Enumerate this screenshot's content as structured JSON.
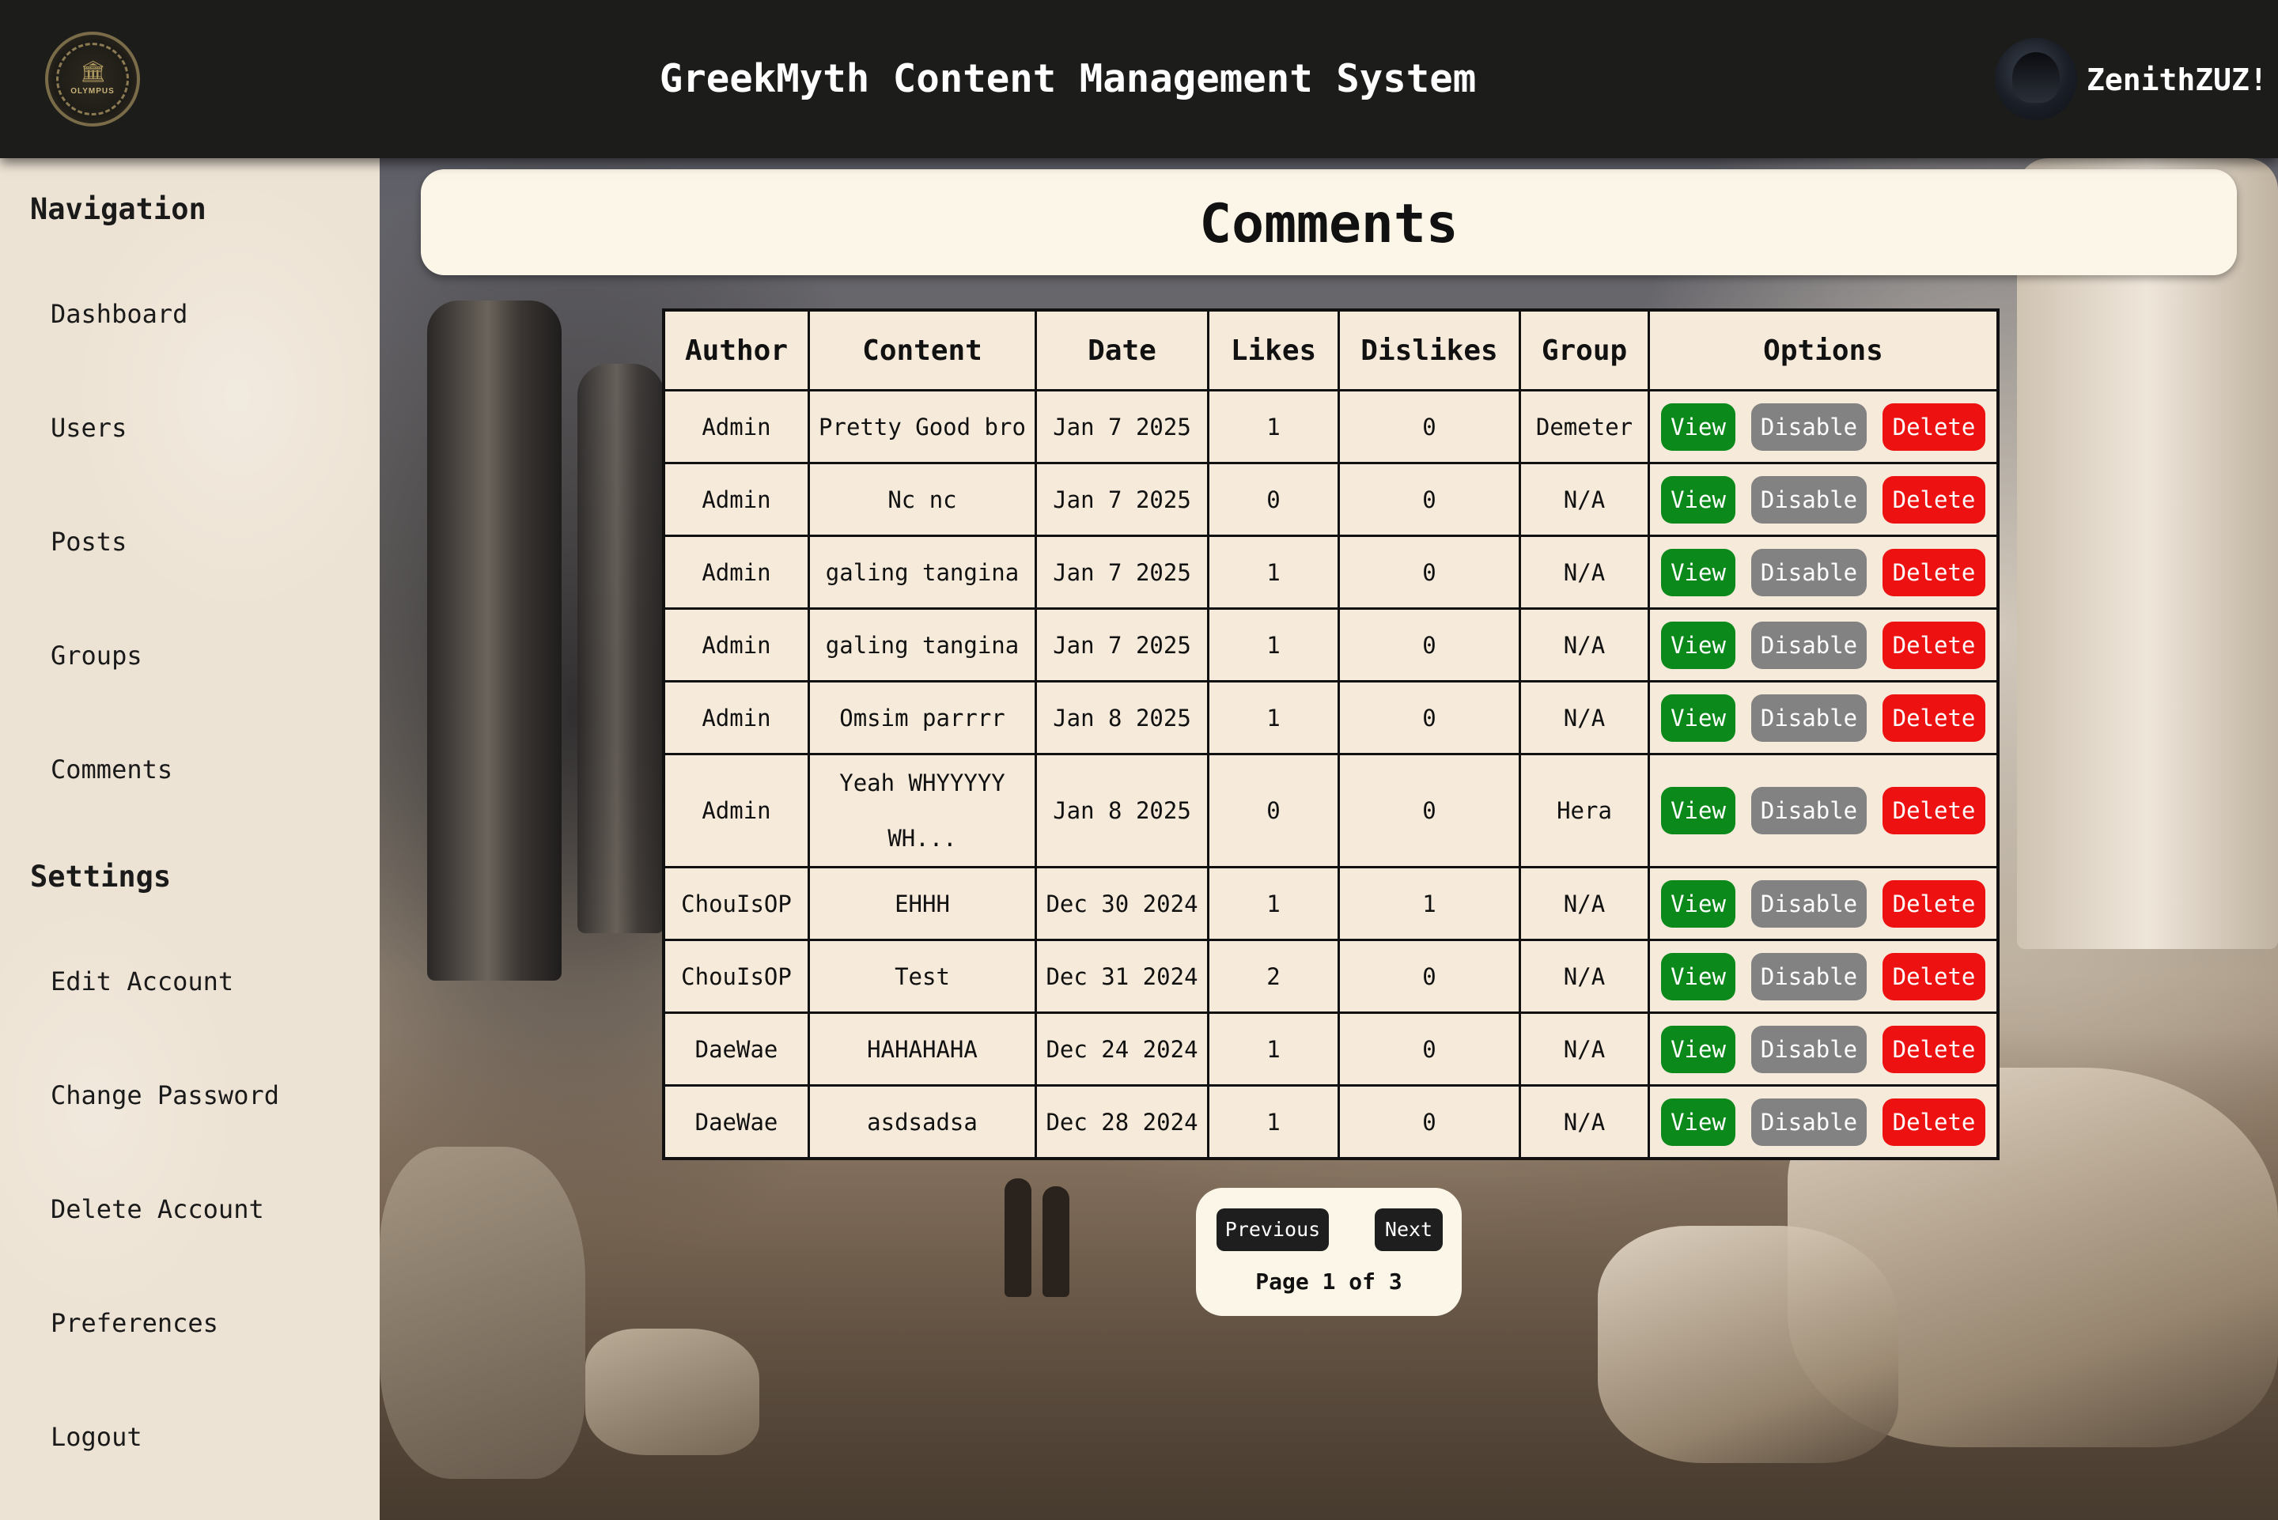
{
  "header": {
    "logo_text": "OLYMPUS",
    "title": "GreekMyth Content Management System",
    "username": "ZenithZUZ!"
  },
  "sidebar": {
    "navigation_heading": "Navigation",
    "nav_items": [
      {
        "label": "Dashboard"
      },
      {
        "label": "Users"
      },
      {
        "label": "Posts"
      },
      {
        "label": "Groups"
      },
      {
        "label": "Comments"
      }
    ],
    "settings_heading": "Settings",
    "settings_items": [
      {
        "label": "Edit Account"
      },
      {
        "label": "Change Password"
      },
      {
        "label": "Delete Account"
      },
      {
        "label": "Preferences"
      },
      {
        "label": "Logout"
      }
    ]
  },
  "main": {
    "page_title": "Comments",
    "table": {
      "headers": {
        "author": "Author",
        "content": "Content",
        "date": "Date",
        "likes": "Likes",
        "dislikes": "Dislikes",
        "group": "Group",
        "options": "Options"
      },
      "button_labels": {
        "view": "View",
        "disable": "Disable",
        "delete": "Delete"
      },
      "rows": [
        {
          "author": "Admin",
          "content": "Pretty Good bro",
          "date": "Jan 7 2025",
          "likes": "1",
          "dislikes": "0",
          "group": "Demeter"
        },
        {
          "author": "Admin",
          "content": "Nc nc",
          "date": "Jan 7 2025",
          "likes": "0",
          "dislikes": "0",
          "group": "N/A"
        },
        {
          "author": "Admin",
          "content": "galing tangina",
          "date": "Jan 7 2025",
          "likes": "1",
          "dislikes": "0",
          "group": "N/A"
        },
        {
          "author": "Admin",
          "content": "galing tangina",
          "date": "Jan 7 2025",
          "likes": "1",
          "dislikes": "0",
          "group": "N/A"
        },
        {
          "author": "Admin",
          "content": "Omsim parrrr",
          "date": "Jan 8 2025",
          "likes": "1",
          "dislikes": "0",
          "group": "N/A"
        },
        {
          "author": "Admin",
          "content_line1": "Yeah WHYYYYY",
          "content_line2": "WH...",
          "date": "Jan 8 2025",
          "likes": "0",
          "dislikes": "0",
          "group": "Hera"
        },
        {
          "author": "ChouIsOP",
          "content": "EHHH",
          "date": "Dec 30 2024",
          "likes": "1",
          "dislikes": "1",
          "group": "N/A"
        },
        {
          "author": "ChouIsOP",
          "content": "Test",
          "date": "Dec 31 2024",
          "likes": "2",
          "dislikes": "0",
          "group": "N/A"
        },
        {
          "author": "DaeWae",
          "content": "HAHAHAHA",
          "date": "Dec 24 2024",
          "likes": "1",
          "dislikes": "0",
          "group": "N/A"
        },
        {
          "author": "DaeWae",
          "content": "asdsadsa",
          "date": "Dec 28 2024",
          "likes": "1",
          "dislikes": "0",
          "group": "N/A"
        }
      ]
    },
    "pagination": {
      "previous_label": "Previous",
      "next_label": "Next",
      "page_info": "Page 1 of 3"
    }
  },
  "colors": {
    "header_bg": "#1c1c1a",
    "sidebar_bg": "#ede3d4",
    "table_bg": "#f6ebdb",
    "view_button": "#0b8a1b",
    "disable_button": "#828282",
    "delete_button": "#ee1111"
  },
  "icons": {
    "logo": "olympus-temple-logo",
    "avatar": "user-avatar"
  }
}
